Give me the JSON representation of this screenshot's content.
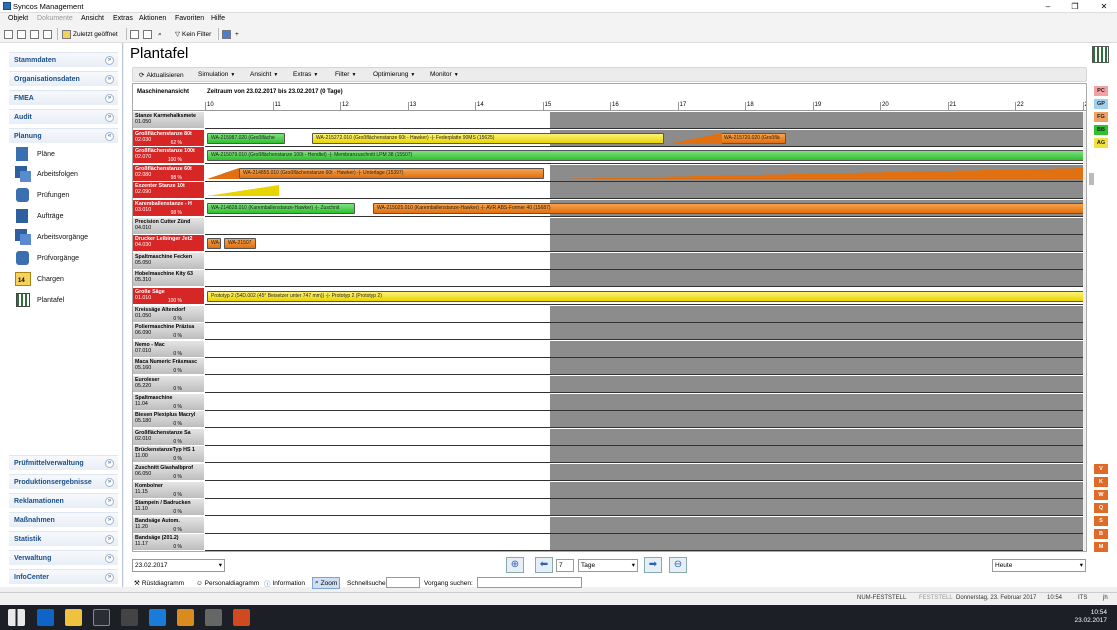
{
  "window": {
    "title": "Syncos Management",
    "controls": [
      "–",
      "❐",
      "✕"
    ]
  },
  "menu": [
    "Objekt",
    "Dokumente",
    "Ansicht",
    "Extras",
    "Aktionen",
    "Favoriten",
    "Hilfe"
  ],
  "toolbar": {
    "recent": "Zuletzt geöffnet",
    "no_filter": "Kein Filter"
  },
  "sidebar": {
    "top": [
      "Stammdaten",
      "Organisationsdaten",
      "FMEA",
      "Audit",
      "Planung"
    ],
    "planung_items": [
      "Pläne",
      "Arbeitsfolgen",
      "Prüfungen",
      "Aufträge",
      "Arbeitsvorgänge",
      "Prüfvorgänge",
      "Chargen",
      "Plantafel"
    ],
    "calendar_badge": "14",
    "bottom": [
      "Prüfmittelverwaltung",
      "Produktionsergebnisse",
      "Reklamationen",
      "Maßnahmen",
      "Statistik",
      "Verwaltung",
      "InfoCenter"
    ]
  },
  "page": {
    "title": "Plantafel"
  },
  "ptool": [
    "Aktualisieren",
    "Simulation",
    "Ansicht",
    "Extras",
    "Filter",
    "Optimierung",
    "Monitor"
  ],
  "gantt": {
    "machines_header": "Maschinenansicht",
    "range": "Zeitraum von 23.02.2017 bis 23.02.2017 (0 Tage)",
    "date_label": "23.02.2017",
    "ticks": [
      "10",
      "11",
      "12",
      "13",
      "14",
      "15",
      "16",
      "17",
      "18",
      "19",
      "20",
      "21",
      "22",
      "23"
    ],
    "rows": [
      {
        "name": "Stanze Karmehalksmete",
        "code": "01.050",
        "pct": "",
        "color": "gray",
        "shade": true
      },
      {
        "name": "Großflächenstanze 80t",
        "code": "02.030",
        "pct": "62 %",
        "color": "red",
        "shade": true
      },
      {
        "name": "Großflächenstanze 100t",
        "code": "02.070",
        "pct": "100 %",
        "color": "red",
        "shade": false
      },
      {
        "name": "Großflächenstanze 60t",
        "code": "02.080",
        "pct": "98 %",
        "color": "red",
        "shade": true
      },
      {
        "name": "Exzenter Stanze 10t",
        "code": "02.090",
        "pct": "",
        "color": "red",
        "shade": true
      },
      {
        "name": "Karemballenstanze - H",
        "code": "03.010",
        "pct": "98 %",
        "color": "red",
        "shade": true
      },
      {
        "name": "Precision Cutter Zünd",
        "code": "04.010",
        "pct": "",
        "color": "gray",
        "shade": true
      },
      {
        "name": "Drucker Leibinger Jet2",
        "code": "04.030",
        "pct": "",
        "color": "red",
        "shade": true
      },
      {
        "name": "Spaltmaschine Fecken",
        "code": "05.050",
        "pct": "",
        "color": "gray",
        "shade": true
      },
      {
        "name": "Hobelmaschine Kity 63",
        "code": "05.310",
        "pct": "",
        "color": "gray",
        "shade": true
      },
      {
        "name": "Große Säge",
        "code": "01.010",
        "pct": "100 %",
        "color": "red",
        "shade": false
      },
      {
        "name": "Kreissäge Altendorf",
        "code": "01.050",
        "pct": "0 %",
        "color": "gray",
        "shade": true
      },
      {
        "name": "Poliermaschine Präzisa",
        "code": "06.090",
        "pct": "0 %",
        "color": "gray",
        "shade": true
      },
      {
        "name": "Nemo - Mac",
        "code": "07.010",
        "pct": "0 %",
        "color": "gray",
        "shade": true
      },
      {
        "name": "Maca Numeric Fräsmasc",
        "code": "05.160",
        "pct": "0 %",
        "color": "gray",
        "shade": true
      },
      {
        "name": "Euroleser",
        "code": "05.220",
        "pct": "0 %",
        "color": "gray",
        "shade": true
      },
      {
        "name": "Spaltmaschine",
        "code": "11.04",
        "pct": "0 %",
        "color": "gray",
        "shade": true
      },
      {
        "name": "Biesen Plexiplus Macryl",
        "code": "05.180",
        "pct": "0 %",
        "color": "gray",
        "shade": true
      },
      {
        "name": "Großflächenstanze Sa",
        "code": "02.010",
        "pct": "0 %",
        "color": "gray",
        "shade": true
      },
      {
        "name": "BrückenstanzeTyp HS 1",
        "code": "11.00",
        "pct": "0 %",
        "color": "gray",
        "shade": true
      },
      {
        "name": "Zuschnitt Glashalbprof",
        "code": "06.050",
        "pct": "0 %",
        "color": "gray",
        "shade": true
      },
      {
        "name": "Kombolner",
        "code": "11.15",
        "pct": "0 %",
        "color": "gray",
        "shade": true
      },
      {
        "name": "Stampein / Badrucken",
        "code": "11.10",
        "pct": "0 %",
        "color": "gray",
        "shade": true
      },
      {
        "name": "Bandsäge Autom.",
        "code": "11.20",
        "pct": "0 %",
        "color": "gray",
        "shade": true
      },
      {
        "name": "Bandsäge (201.2)",
        "code": "11.17",
        "pct": "0 %",
        "color": "gray",
        "shade": true
      }
    ],
    "bars": [
      {
        "row": 1,
        "color": "green",
        "text": "WA-215987.020 (Großfläche"
      },
      {
        "row": 1,
        "color": "yellow",
        "text": "WA-215272.010 (Großflächenstanze 60t - Hawker) -|- Federplatte 90MS (15625)"
      },
      {
        "row": 1,
        "color": "orange",
        "text": "WA-215720.020 (Großflä"
      },
      {
        "row": 2,
        "color": "green",
        "text": "WA-215079.010 (Großflächenstanze 100t - Hendtel) -|- Membranzuschnitt LPM 38 (15507)"
      },
      {
        "row": 3,
        "color": "orange",
        "text": "WA-214855.010 (Großflächenstanze 60t - Hawker) -|- Unterlage (15397)"
      },
      {
        "row": 5,
        "color": "green",
        "text": "WA-214828.010 (Karemballenstanze-Hawker) -|- Zuschnit"
      },
      {
        "row": 5,
        "color": "orange",
        "text": "WA-215025.010 (Karemballenstanze-Hawker) -|- AVR ABS-Former 40 (15687)"
      },
      {
        "row": 7,
        "color": "orange",
        "text": "WA-"
      },
      {
        "row": 7,
        "color": "orange",
        "text": "WA-21507"
      },
      {
        "row": 10,
        "color": "yellow",
        "text": "Prototyp 2 (54D.002 (45° Beisetzer unter 747 mm)) -|- Prototyp 2 (Prototyp 2)"
      }
    ]
  },
  "right_tags": {
    "top": [
      "PC",
      "GP",
      "FG",
      "BB",
      "AG"
    ],
    "bottom": [
      "V",
      "K",
      "W",
      "Q",
      "S",
      "B",
      "M"
    ]
  },
  "bottom": {
    "date": "23.02.2017",
    "days_value": "7",
    "unit": "Tage",
    "today": "Heute"
  },
  "tabs": [
    "Rüstdiagramm",
    "Personaldiagramm",
    "Information",
    "Zoom",
    "Schnellsuche:",
    "Vorgang suchen:"
  ],
  "status": {
    "num": "NUM-FESTSTELL",
    "fest": "FESTSTELL",
    "date": "Donnerstag, 23. Februar 2017",
    "time": "10:54",
    "its": "ITS",
    "lang": "jh"
  },
  "clock": {
    "time": "10:54",
    "date": "23.02.2017"
  },
  "colors": {
    "accent": "#1a4f8a",
    "red": "#d72626",
    "shade": "#8c8c8c"
  }
}
